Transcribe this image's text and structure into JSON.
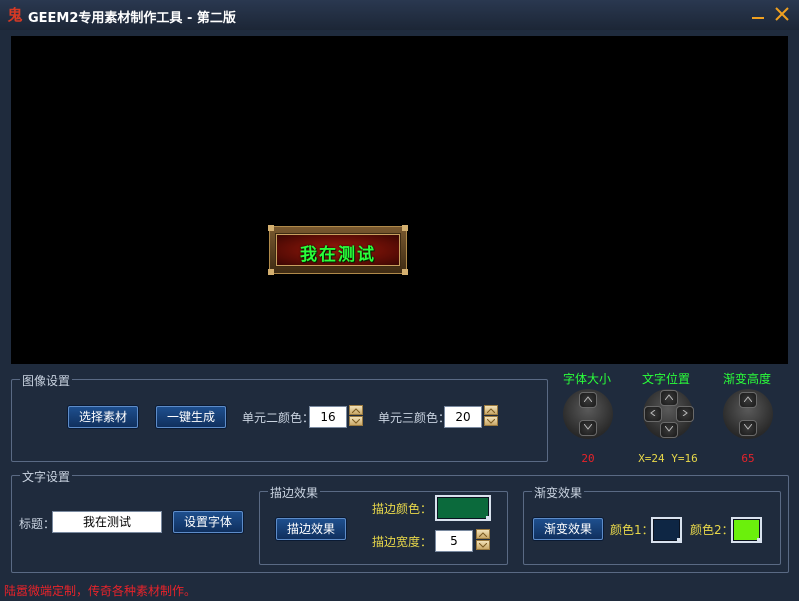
{
  "window": {
    "title": "GEEM2专用素材制作工具 - 第二版",
    "app_icon_glyph": "鬼"
  },
  "preview": {
    "button_text": "我在测试"
  },
  "image_settings": {
    "title": "图像设置",
    "select_button": "选择素材",
    "generate_button": "一键生成",
    "unit2_color_label": "单元二颜色：",
    "unit2_color_value": "16",
    "unit3_color_label": "单元三颜色：",
    "unit3_color_value": "20"
  },
  "dials": {
    "font_size": {
      "label": "字体大小",
      "value": "20"
    },
    "text_position": {
      "label": "文字位置",
      "value": "X=24 Y=16"
    },
    "gradient_height": {
      "label": "渐变高度",
      "value": "65"
    }
  },
  "text_settings": {
    "title": "文字设置",
    "title_label": "标题：",
    "title_value": "我在测试",
    "set_font_button": "设置字体"
  },
  "stroke_effect": {
    "title": "描边效果",
    "button": "描边效果",
    "color_label": "描边颜色：",
    "color": "#0b6a3c",
    "width_label": "描边宽度：",
    "width_value": "5"
  },
  "gradient_effect": {
    "title": "渐变效果",
    "button": "渐变效果",
    "color1_label": "颜色1：",
    "color1": "#0e2644",
    "color2_label": "颜色2：",
    "color2": "#6bf00c"
  },
  "status_text": "陆嚣微端定制，传奇各种素材制作。",
  "colors": {
    "accent_green": "#2aff3a",
    "value_red": "#e8232a",
    "label_yellow": "#e8d84a"
  }
}
